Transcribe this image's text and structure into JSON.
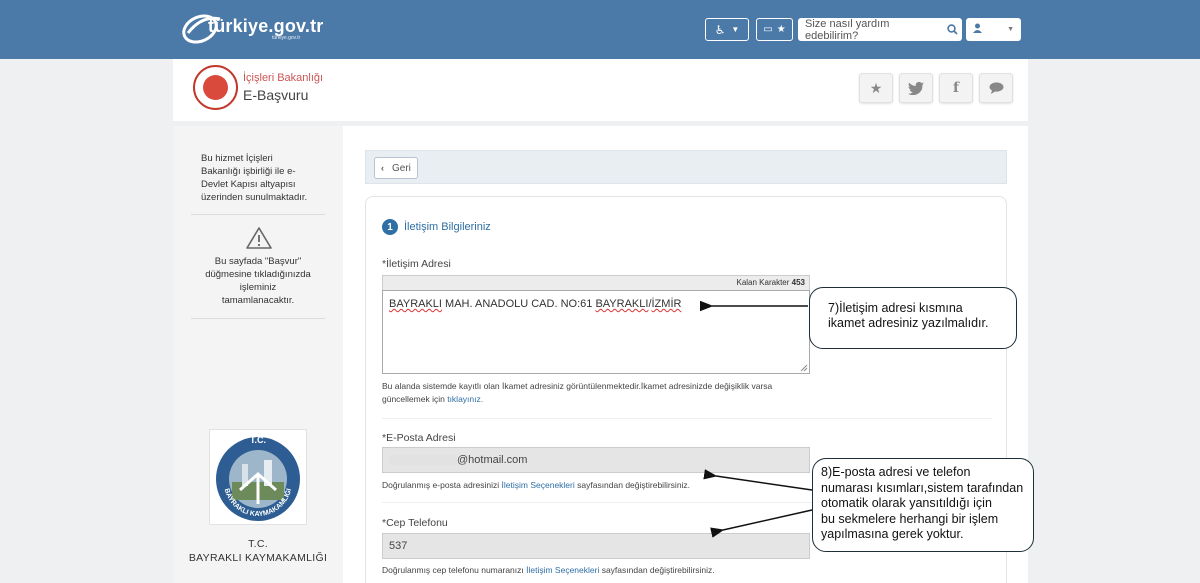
{
  "topbar": {
    "logo_text": "türkiye.gov.tr",
    "logo_sub": "türkiye.gov.tr",
    "search_placeholder": "Size nasıl yardım edebilirim?"
  },
  "header": {
    "ministry": "İçişleri Bakanlığı",
    "service": "E-Başvuru"
  },
  "sidebar": {
    "info": [
      "Bu hizmet İçişleri",
      "Bakanlığı işbirliği ile e-",
      "Devlet Kapısı altyapısı",
      "üzerinden sunulmaktadır."
    ],
    "warning": [
      "Bu sayfada \"Başvur\"",
      "düğmesine tıkladığınızda",
      "işleminiz",
      "tamamlanacaktır."
    ],
    "logo_top": "T.C.",
    "logo_ring": "BAYRAKLI KAYMAKAMLIĞI",
    "org_line1": "T.C.",
    "org_line2": "BAYRAKLI KAYMAKAMLIĞI"
  },
  "main": {
    "back_label": "Geri",
    "step_number": "1",
    "step_label": "İletişim Bilgileriniz",
    "address": {
      "label": "*İletişim Adresi",
      "counter_label": "Kalan Karakter",
      "counter_value": "453",
      "value_parts": [
        "BAYRAKLI",
        " MAH. ANADOLU CAD. NO:61 ",
        "BAYRAKLI",
        "/",
        "İZMİR"
      ],
      "help_line1": "Bu alanda sistemde kayıtlı olan İkamet adresiniz görüntülenmektedir.İkamet adresinizde değişiklik varsa",
      "help_line2_prefix": "güncellemek için ",
      "help_link": "tıklayınız."
    },
    "email": {
      "label": "*E-Posta Adresi",
      "value": "@hotmail.com",
      "help_prefix": "Doğrulanmış e-posta adresinizi ",
      "help_link": "İletişim Seçenekleri",
      "help_suffix": " sayfasından değiştirebilirsiniz."
    },
    "phone": {
      "label": "*Cep Telefonu",
      "value": "537",
      "help_prefix": "Doğrulanmış cep telefonu numaranızı ",
      "help_link": "İletişim Seçenekleri",
      "help_suffix": " sayfasından değiştirebilirsiniz."
    }
  },
  "callouts": {
    "address_note": [
      "7)İletişim adresi kısmına",
      "ikamet adresiniz yazılmalıdır."
    ],
    "contact_note": [
      "8)E-posta adresi ve telefon",
      "numarası kısımları,sistem tarafından",
      "otomatik olarak yansıtıldığı için",
      "bu sekmelere herhangi bir işlem",
      "yapılmasına gerek yoktur."
    ]
  },
  "colors": {
    "topbar": "#4b79a8",
    "accent": "#2f6fa5",
    "ministry_red": "#c0392b"
  },
  "icons": [
    "accessibility-icon",
    "chevron-down-icon",
    "id-card-icon",
    "star-icon",
    "search-icon",
    "user-icon",
    "twitter-icon",
    "facebook-icon",
    "comment-icon",
    "chevron-left-icon",
    "warning-icon"
  ]
}
